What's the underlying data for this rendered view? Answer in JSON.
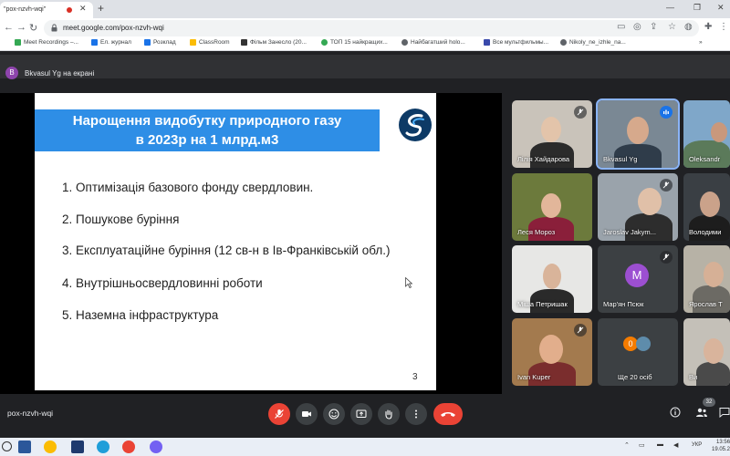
{
  "browser": {
    "tab_title": "\"pox-nzvh-wqi\"",
    "url": "meet.google.com/pox-nzvh-wqi",
    "bookmarks": [
      {
        "label": "Meet Recordings –..."
      },
      {
        "label": "Ел. журнал"
      },
      {
        "label": "Розклад"
      },
      {
        "label": "ClassRoom"
      },
      {
        "label": "Фільм Занесло (20..."
      },
      {
        "label": "ТОП 15 найкращих..."
      },
      {
        "label": "Найбагатший holo..."
      },
      {
        "label": "Все мультфильмы..."
      },
      {
        "label": "Nikoly_ne_izhle_na..."
      }
    ]
  },
  "meet": {
    "presenter_initial": "B",
    "presenter_label": "Bkvasul Yg на екрані",
    "meeting_code": "pox-nzvh-wqi",
    "people_count": "32",
    "slide": {
      "title_line1": "Нарощення видобутку природного газу",
      "title_line2": "в 2023р на 1 млрд.м3",
      "items": [
        "1. Оптимізація базового фонду свердловин.",
        "2. Пошукове буріння",
        "3. Експлуатаційне буріння (12 св-н в Ів-Франківській обл.)",
        "4. Внутрішньосвердловинні роботи",
        "5. Наземна інфраструктура"
      ],
      "page": "3"
    },
    "tiles": [
      {
        "name": "Лілія Хайдарова"
      },
      {
        "name": "Bkvasul Yg"
      },
      {
        "name": "Oleksandr"
      },
      {
        "name": "Леся Мороз"
      },
      {
        "name": "Jaroslav Jakym..."
      },
      {
        "name": "Володими"
      },
      {
        "name": "Міша Петришак"
      },
      {
        "name": "Мар'ян Псюк",
        "initial": "M"
      },
      {
        "name": "Ярослав Т"
      },
      {
        "name": "Ivan Kuper"
      },
      {
        "name": "Ще 20 осіб",
        "initial": "0"
      },
      {
        "name": "Ви"
      }
    ]
  },
  "taskbar": {
    "lang": "УКР",
    "time": "13:56",
    "date": "19.05.2"
  },
  "colors": {
    "accent_blue": "#2e8ee6",
    "hangup_red": "#ea4335",
    "meet_bg": "#202124"
  }
}
